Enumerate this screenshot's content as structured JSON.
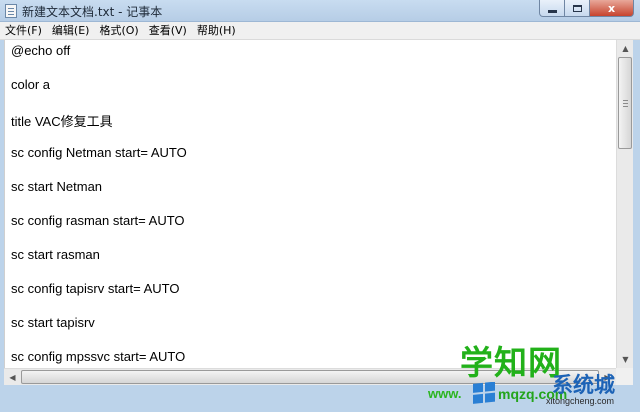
{
  "window": {
    "title": "新建文本文档.txt - 记事本",
    "icon": "notepad-icon",
    "controls": {
      "close_label": "x"
    }
  },
  "menu": [
    {
      "label": "文件(F)"
    },
    {
      "label": "编辑(E)"
    },
    {
      "label": "格式(O)"
    },
    {
      "label": "查看(V)"
    },
    {
      "label": "帮助(H)"
    }
  ],
  "editor": {
    "lines": [
      "@echo off",
      "color a",
      "title VAC修复工具",
      "sc config Netman start= AUTO",
      "sc start Netman",
      "sc config rasman start= AUTO",
      "sc start rasman",
      "sc config tapisrv start= AUTO",
      "sc start tapisrv",
      "sc config mpssvc start= AUTO"
    ]
  },
  "watermark": {
    "title": "学知网",
    "www": "www.",
    "domain": "mqzq.com",
    "system": "系统城",
    "url": "xitongcheng.com"
  },
  "colors": {
    "frame": "#bcd3ea",
    "watermark_green": "#22b11a",
    "watermark_blue": "#1d63b6",
    "close_button": "#c7432d"
  }
}
